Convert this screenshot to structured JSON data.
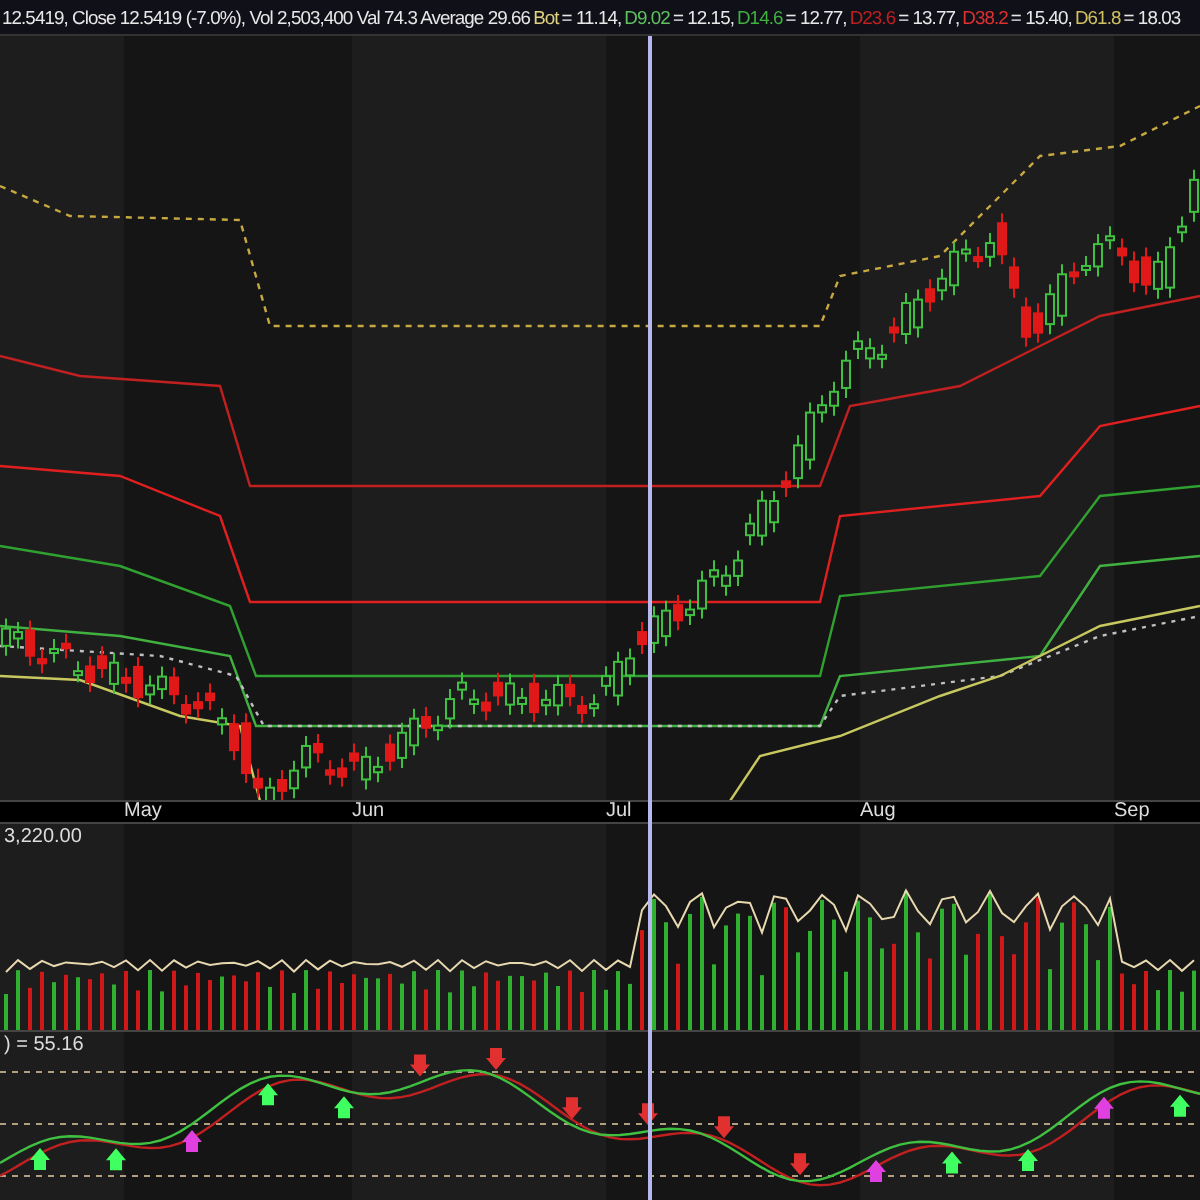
{
  "header": [
    {
      "text": "12.5419, Close 12.5419 (-7.0%), Vol 2,503,400 Val 74.3 Average 29.66",
      "color": "#e8e8e8"
    },
    {
      "text": "Bot",
      "color": "#e0d080"
    },
    {
      "text": "= 11.14,",
      "color": "#e8e8e8"
    },
    {
      "text": "D9.02",
      "color": "#60c060"
    },
    {
      "text": "= 12.15,",
      "color": "#e8e8e8"
    },
    {
      "text": "D14.6",
      "color": "#40b040"
    },
    {
      "text": "= 12.77,",
      "color": "#e8e8e8"
    },
    {
      "text": "D23.6",
      "color": "#c02020"
    },
    {
      "text": "= 13.77,",
      "color": "#e8e8e8"
    },
    {
      "text": "D38.2",
      "color": "#e03030"
    },
    {
      "text": "= 15.40,",
      "color": "#e8e8e8"
    },
    {
      "text": "D61.8",
      "color": "#d0c060"
    },
    {
      "text": "= 18.03",
      "color": "#e8e8e8"
    }
  ],
  "x_axis": {
    "labels": [
      "May",
      "Jun",
      "Jul",
      "Aug",
      "Sep"
    ]
  },
  "volume_panel": {
    "label": "3,220.00"
  },
  "oscillator_panel": {
    "label": ") = 55.16"
  }
}
